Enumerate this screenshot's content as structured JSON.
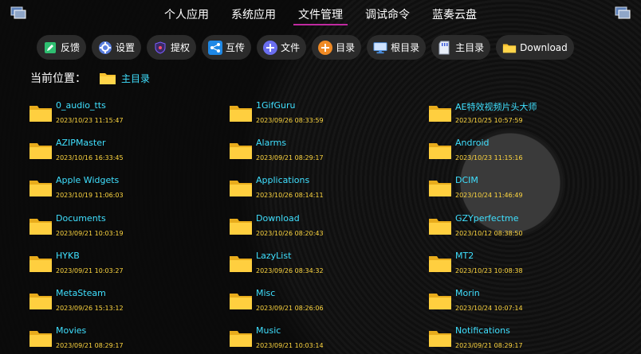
{
  "tabs": [
    {
      "label": "个人应用"
    },
    {
      "label": "系统应用"
    },
    {
      "label": "文件管理",
      "active": true
    },
    {
      "label": "调试命令"
    },
    {
      "label": "蓝奏云盘"
    }
  ],
  "toolbar": {
    "feedback": "反馈",
    "settings": "设置",
    "authorize": "提权",
    "transfer": "互传",
    "file": "文件",
    "directory": "目录",
    "root_directory": "根目录",
    "main_directory": "主目录",
    "download": "Download"
  },
  "location": {
    "label": "当前位置：",
    "value": "主目录"
  },
  "files": [
    {
      "name": "0_audio_tts",
      "date": "2023/10/23 11:15:47"
    },
    {
      "name": "1GifGuru",
      "date": "2023/09/26 08:33:59"
    },
    {
      "name": "AE特效视频片头大师",
      "date": "2023/10/25 10:57:59"
    },
    {
      "name": "AZIPMaster",
      "date": "2023/10/16 16:33:45"
    },
    {
      "name": "Alarms",
      "date": "2023/09/21 08:29:17"
    },
    {
      "name": "Android",
      "date": "2023/10/23 11:15:16"
    },
    {
      "name": "Apple Widgets",
      "date": "2023/10/19 11:06:03"
    },
    {
      "name": "Applications",
      "date": "2023/10/26 08:14:11"
    },
    {
      "name": "DCIM",
      "date": "2023/10/24 11:46:49"
    },
    {
      "name": "Documents",
      "date": "2023/09/21 10:03:19"
    },
    {
      "name": "Download",
      "date": "2023/10/26 08:20:43"
    },
    {
      "name": "GZYperfectme",
      "date": "2023/10/12 08:38:50"
    },
    {
      "name": "HYKB",
      "date": "2023/09/21 10:03:27"
    },
    {
      "name": "LazyList",
      "date": "2023/09/26 08:34:32"
    },
    {
      "name": "MT2",
      "date": "2023/10/23 10:08:38"
    },
    {
      "name": "MetaSteam",
      "date": "2023/09/26 15:13:12"
    },
    {
      "name": "Misc",
      "date": "2023/09/21 08:26:06"
    },
    {
      "name": "Morin",
      "date": "2023/10/24 10:07:14"
    },
    {
      "name": "Movies",
      "date": "2023/09/21 08:29:17"
    },
    {
      "name": "Music",
      "date": "2023/09/21 10:03:14"
    },
    {
      "name": "Notifications",
      "date": "2023/09/21 08:29:17"
    }
  ],
  "icons": {
    "feedback": "pencil-icon",
    "settings": "gear-icon",
    "authorize": "shield-icon",
    "transfer": "share-icon",
    "file": "plus-icon",
    "directory": "plus-icon",
    "root_directory": "monitor-icon",
    "main_directory": "sd-card-icon",
    "download": "folder-icon",
    "corner_left": "window-icon",
    "corner_right": "window-icon"
  },
  "colors": {
    "accent_underline": "#c02aa0",
    "file_name": "#3fe0ff",
    "file_date": "#ffd740",
    "folder": "#f7c22f",
    "button_bg": "#2b2b2b"
  }
}
